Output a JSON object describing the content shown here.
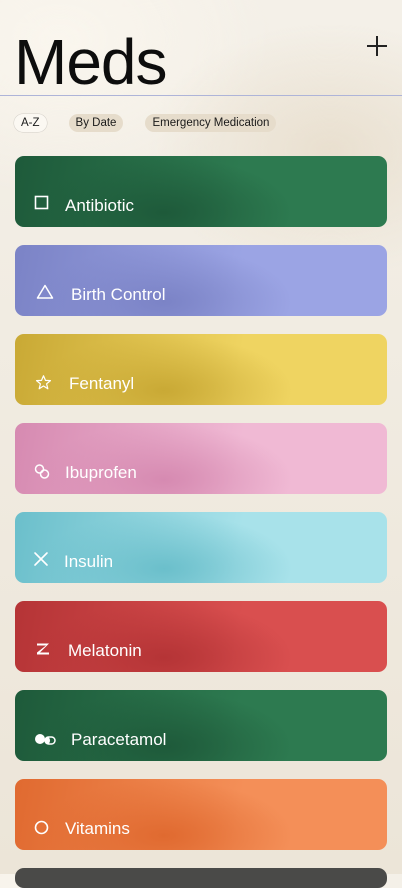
{
  "header": {
    "title": "Meds",
    "add_label": "+"
  },
  "filters": [
    {
      "label": "A-Z",
      "active": true
    },
    {
      "label": "By Date",
      "active": false
    },
    {
      "label": "Emergency Medication",
      "active": false
    }
  ],
  "meds": [
    {
      "name": "Antibiotic",
      "icon": "square-icon",
      "color": "#2d7a50",
      "color_dark": "#1e5a3a"
    },
    {
      "name": "Birth Control",
      "icon": "triangle-icon",
      "color": "#9ba4e4",
      "color_dark": "#7b83c6"
    },
    {
      "name": "Fentanyl",
      "icon": "star-icon",
      "color": "#efd461",
      "color_dark": "#c9a935"
    },
    {
      "name": "Ibuprofen",
      "icon": "link-circles-icon",
      "color": "#f0b9d4",
      "color_dark": "#d68ab1"
    },
    {
      "name": "Insulin",
      "icon": "cross-icon",
      "color": "#a8e2ea",
      "color_dark": "#6bbfcb"
    },
    {
      "name": "Melatonin",
      "icon": "sleep-z-icon",
      "color": "#d94f4f",
      "color_dark": "#b53436"
    },
    {
      "name": "Paracetamol",
      "icon": "pills-icon",
      "color": "#2d7a50",
      "color_dark": "#1e5a3a"
    },
    {
      "name": "Vitamins",
      "icon": "circle-icon",
      "color": "#f48f58",
      "color_dark": "#e06a30"
    }
  ]
}
